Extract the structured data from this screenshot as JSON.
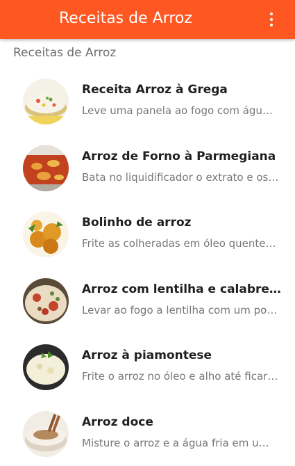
{
  "app": {
    "title": "Receitas de Arroz",
    "theme_color": "#ff5722",
    "menu_icon": "overflow-menu-icon"
  },
  "section": {
    "header": "Receitas de Arroz"
  },
  "recipes": [
    {
      "title": "Receita Arroz à Grega",
      "preview": "Leve uma panela ao fogo com água, sal e óleo",
      "image": "arroz-grega-photo"
    },
    {
      "title": "Arroz de Forno à Parmegiana",
      "preview": "Bata no liquidificador o extrato e os temperos",
      "image": "arroz-parmegiana-photo"
    },
    {
      "title": "Bolinho de arroz",
      "preview": "Frite as colheradas em óleo quente, deixando dourar",
      "image": "bolinho-arroz-photo"
    },
    {
      "title": "Arroz com lentilha e calabresa",
      "preview": "Levar ao fogo a lentilha com um pouco de água",
      "image": "arroz-lentilha-photo"
    },
    {
      "title": "Arroz à piamontese",
      "preview": "Frite o arroz no óleo e alho até ficar soltinho",
      "image": "arroz-piamontese-photo"
    },
    {
      "title": "Arroz doce",
      "preview": "Misture o arroz e a água fria em uma panela",
      "image": "arroz-doce-photo"
    }
  ]
}
